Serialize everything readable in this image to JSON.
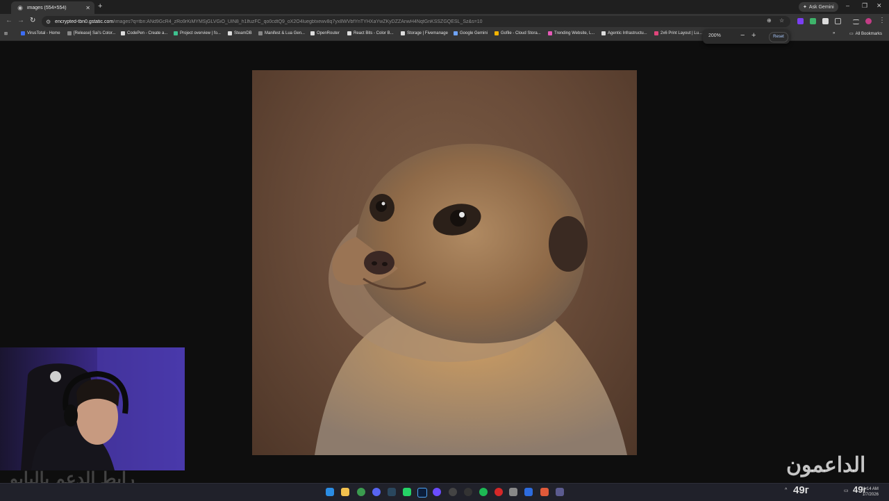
{
  "browser": {
    "tab": {
      "title": "images (554×554)"
    },
    "new_tab_label": "+",
    "gemini_label": "Ask Gemini",
    "window": {
      "minimize": "–",
      "maximize": "❐",
      "close": "✕"
    }
  },
  "omnibox": {
    "url_host": "encrypted-tbn0.gstatic.com",
    "url_path": "/images?q=tbn:ANd9GcR4_zRo9rKiMYMSjGLVGiO_UIN8_h1lfuzFC_qo0cdtQ9_oX2O4luegbtxewv8q7yx8WVbfYnTYHXaYwZKyDZZAnwH4NqtGnKSSZGQESL_Sz&s=10"
  },
  "bookmarks": [
    {
      "label": "VirusTotal - Home",
      "color": "#3d6df2"
    },
    {
      "label": "[Release] Sai's Color...",
      "color": "#888888"
    },
    {
      "label": "CodePen - Create a...",
      "color": "#dddddd"
    },
    {
      "label": "Project overview | fo...",
      "color": "#3ec28f"
    },
    {
      "label": "SteamDB",
      "color": "#dddddd"
    },
    {
      "label": "Manifest & Lua Gen...",
      "color": "#888888"
    },
    {
      "label": "OpenRouter",
      "color": "#dddddd"
    },
    {
      "label": "React Bits - Color B...",
      "color": "#dddddd"
    },
    {
      "label": "Storage | Fivemanage",
      "color": "#dddddd"
    },
    {
      "label": "Google Gemini",
      "color": "#6fa3f7"
    },
    {
      "label": "Gofile - Cloud Stora...",
      "color": "#f5b400"
    },
    {
      "label": "Trending Website, L...",
      "color": "#e75ab8"
    },
    {
      "label": "Agentic Infrastructu...",
      "color": "#dddddd"
    },
    {
      "label": "2x6 Print Layout | Lu...",
      "color": "#e0457b"
    }
  ],
  "all_bookmarks_label": "All Bookmarks",
  "zoom": {
    "level": "200%",
    "minus": "−",
    "plus": "+",
    "reset_label": "Reset"
  },
  "overlay": {
    "watermark_text": "رابط الدعم بالبايو",
    "brand_text": "الداعمون"
  },
  "taskbar": {
    "weather_left": "49ᴦ",
    "weather_right": "49ᴦ",
    "time": "11:14 AM",
    "date": "1/7/2026"
  }
}
